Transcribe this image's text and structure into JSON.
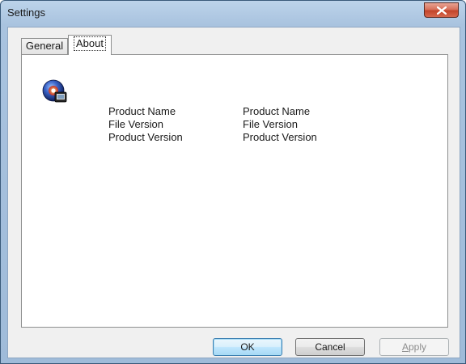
{
  "window": {
    "title": "Settings",
    "close_icon": "close-icon"
  },
  "tabs": [
    {
      "label": "General",
      "selected": false
    },
    {
      "label": "About",
      "selected": true
    }
  ],
  "about": {
    "icon": "application-icon",
    "rows": [
      {
        "label": "Product Name",
        "value": "Product Name"
      },
      {
        "label": "File Version",
        "value": "File Version"
      },
      {
        "label": "Product Version",
        "value": "Product Version"
      }
    ]
  },
  "buttons": {
    "ok": "OK",
    "cancel": "Cancel",
    "apply_first": "A",
    "apply_rest": "pply",
    "apply_enabled": false
  },
  "colors": {
    "frame": "#a9c3df",
    "close": "#c2442a",
    "ok_border": "#3c7fb1"
  }
}
